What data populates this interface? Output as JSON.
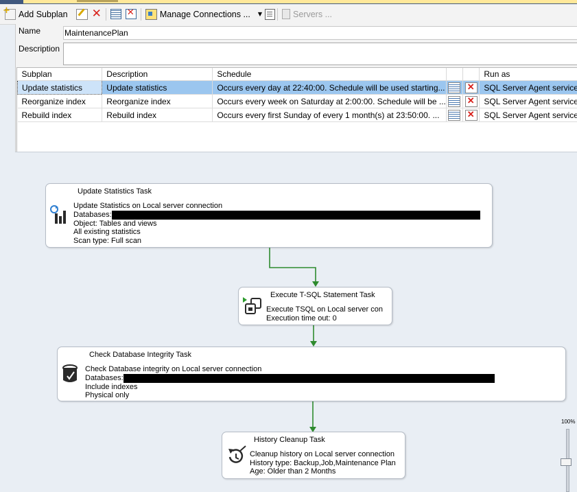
{
  "toolbar": {
    "add_subplan": "Add Subplan",
    "manage_connections": "Manage Connections ...",
    "servers": "Servers ..."
  },
  "properties": {
    "name_label": "Name",
    "name_value": "MaintenancePlan",
    "description_label": "Description",
    "description_value": ""
  },
  "subplans": {
    "columns": [
      "Subplan",
      "Description",
      "Schedule",
      "",
      "",
      "Run as"
    ],
    "rows": [
      {
        "subplan": "Update statistics",
        "description": "Update statistics",
        "schedule": "Occurs every day at 22:40:00. Schedule will be used starting...",
        "run_as": "SQL Server Agent service",
        "selected": true
      },
      {
        "subplan": "Reorganize index",
        "description": "Reorganize index",
        "schedule": "Occurs every week on Saturday at 2:00:00. Schedule will be ...",
        "run_as": "SQL Server Agent service",
        "selected": false
      },
      {
        "subplan": "Rebuild index",
        "description": "Rebuild index",
        "schedule": "Occurs every first Sunday of every 1 month(s) at 23:50:00. ...",
        "run_as": "SQL Server Agent service",
        "selected": false
      }
    ]
  },
  "tasks": {
    "update_stats": {
      "title": "Update Statistics Task",
      "line1": "Update Statistics on Local server connection",
      "databases_label": "Databases:",
      "line3": "Object: Tables and views",
      "line4": "All existing statistics",
      "line5": "Scan type: Full scan"
    },
    "exec_tsql": {
      "title": "Execute T-SQL Statement Task",
      "line1": "Execute TSQL on Local server con",
      "line2": "Execution time out: 0"
    },
    "check_integrity": {
      "title": "Check Database Integrity Task",
      "line1": "Check Database integrity on Local server connection",
      "databases_label": "Databases:",
      "line3": "Include indexes",
      "line4": "Physical only"
    },
    "history_cleanup": {
      "title": "History Cleanup Task",
      "line1": "Cleanup history on Local server connection",
      "line2": "History type: Backup,Job,Maintenance Plan",
      "line3": "Age: Older than 2 Months"
    }
  },
  "zoom": {
    "label": "100%",
    "level_percent": 100
  },
  "colors": {
    "connector": "#2e8b2e",
    "selection": "#9bc6ef",
    "delete": "#d8201a"
  }
}
